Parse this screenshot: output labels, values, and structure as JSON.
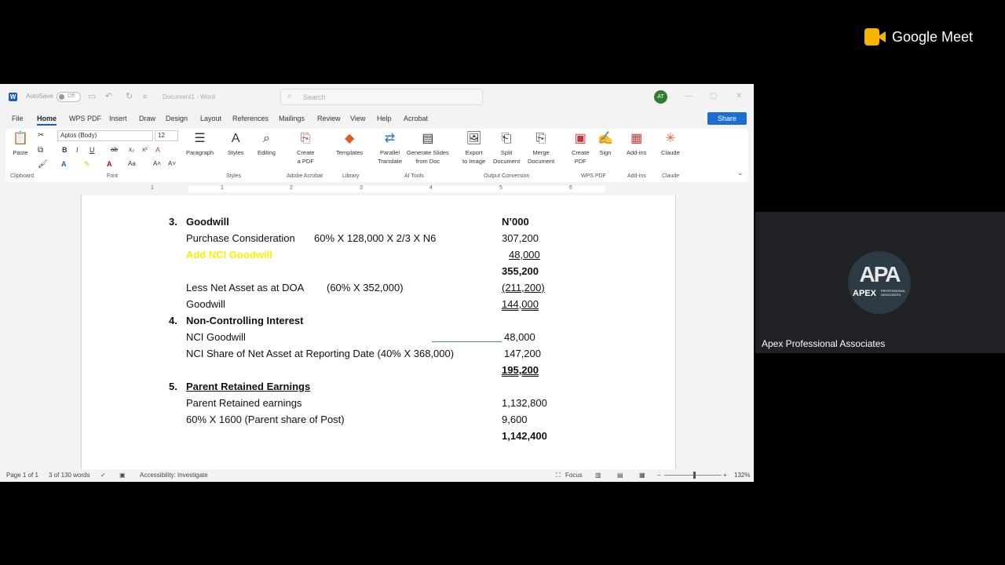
{
  "word": {
    "autosave_label": "AutoSave",
    "autosave_state": "Off",
    "doc_title": "Document1  -  Word",
    "search_placeholder": "Search",
    "user_initials": "AT",
    "menu": [
      "File",
      "Home",
      "WPS PDF",
      "Insert",
      "Draw",
      "Design",
      "Layout",
      "References",
      "Mailings",
      "Review",
      "View",
      "Help",
      "Acrobat"
    ],
    "active_menu": "Home",
    "share_label": "Share",
    "font_name": "Aptos (Body)",
    "font_size": "12",
    "ribbon": {
      "paste": "Paste",
      "paragraph": "Paragraph",
      "styles": "Styles",
      "editing": "Editing",
      "create_pdf": "Create\na PDF",
      "templates": "Templates",
      "parallel": "Parallel\nTranslate",
      "generate": "Generate Slides\nfrom Doc",
      "export": "Export\nto Image",
      "split": "Split\nDocument",
      "merge": "Merge\nDocument",
      "create_pdf2": "Create\nPDF",
      "sign": "Sign",
      "addins": "Add-ins",
      "claude": "Claude"
    },
    "groups": [
      "Clipboard",
      "Font",
      "Styles",
      "Adobe Acrobat",
      "Library",
      "AI Tools",
      "Output Conversion",
      "WPS PDF",
      "Add-ins",
      "Claude"
    ],
    "ruler_nums": [
      "1",
      "1",
      "2",
      "3",
      "4",
      "5",
      "6"
    ],
    "status": {
      "page": "Page 1 of 1",
      "words": "3 of 130 words",
      "accessibility": "Accessibility: Investigate",
      "focus": "Focus",
      "zoom": "132%"
    }
  },
  "document": {
    "s3_num": "3.",
    "s3_title": "Goodwill",
    "col_header": "N’000",
    "purchase_label": "Purchase Consideration",
    "purchase_calc": "60% X 128,000 X 2/3 X N6",
    "purchase_val": "307,200",
    "add_nci": "Add NCI Goodwill",
    "add_nci_val": "48,000",
    "subtotal1": "355,200",
    "less_label": "Less Net Asset as at DOA",
    "less_calc": "(60% X 352,000)",
    "less_val": "(211,200)",
    "goodwill_label": "Goodwill",
    "goodwill_val": "144,000",
    "s4_num": "4.",
    "s4_title": "Non-Controlling Interest",
    "nci_gw_label": "NCI Goodwill",
    "nci_gw_val": "48,000",
    "nci_share_label": "NCI Share of Net Asset at Reporting Date (40% X 368,000)",
    "nci_share_val": "147,200",
    "nci_total": "195,200",
    "s5_num": "5.",
    "s5_title": "Parent Retained Earnings",
    "pre_label": "Parent Retained earnings",
    "pre_val": "1,132,800",
    "post_label": "60% X 1600 (Parent share of Post)",
    "post_val": "9,600",
    "s5_total": "1,142,400"
  },
  "meet": {
    "brand": "Google Meet",
    "participant": "Apex Professional Associates",
    "avatar_mark": "APA",
    "avatar_word": "APEX",
    "avatar_sub": "PROFESSIONAL ASSOCIATES"
  }
}
